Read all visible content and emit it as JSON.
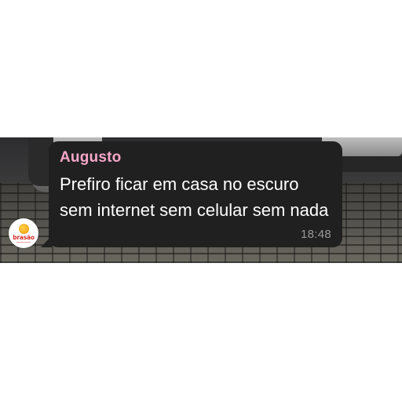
{
  "chat": {
    "message": {
      "sender": "Augusto",
      "text": "Prefiro ficar em casa no escuro sem internet sem celular sem nada",
      "time": "18:48"
    },
    "sender_name_color": "#f5a7c8",
    "bubble_color": "#202020"
  },
  "logo": {
    "text": "brasão",
    "icon": "brand-logo-icon",
    "primary_color": "#d6322b",
    "accent_color": "#f4a81c"
  },
  "background": {
    "description_icon": "photo-background"
  }
}
